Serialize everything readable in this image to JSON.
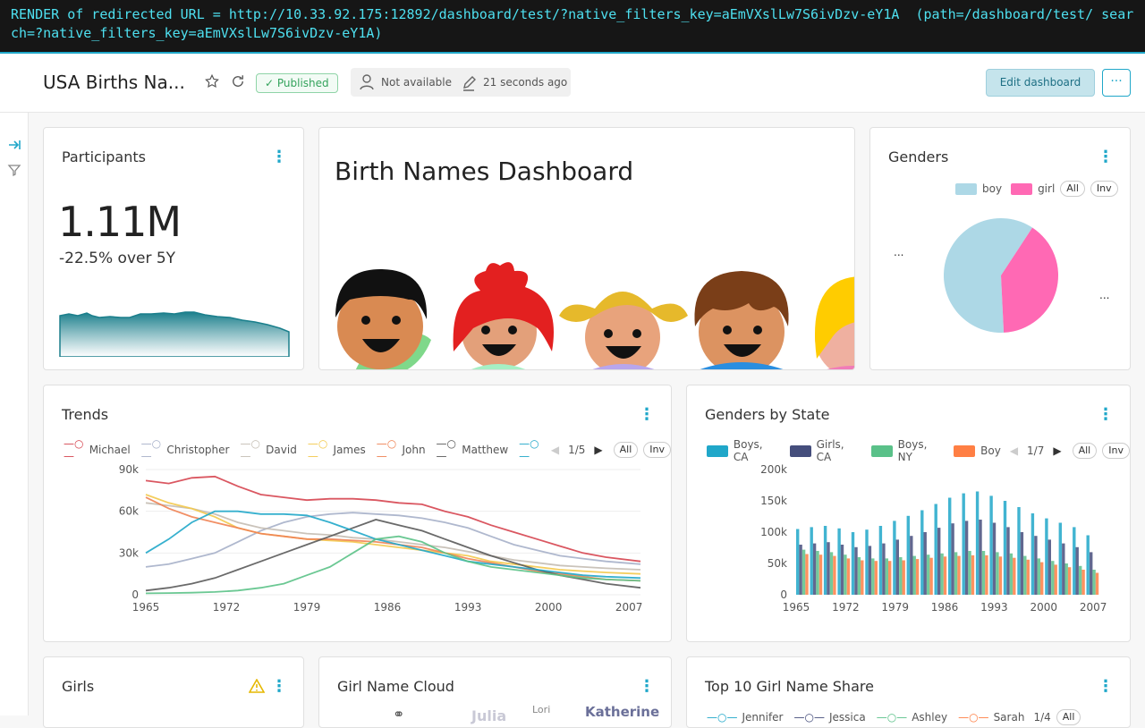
{
  "render_banner": "RENDER of redirected URL = http://10.33.92.175:12892/dashboard/test/?native_filters_key=aEmVXslLw7S6ivDzv-eY1A  (path=/dashboard/test/ search=?native_filters_key=aEmVXslLw7S6ivDzv-eY1A)",
  "header": {
    "title": "USA Births Na...",
    "status": "Published",
    "owner": "Not available",
    "modified": "21 seconds ago",
    "edit_label": "Edit dashboard",
    "more_label": "···"
  },
  "participants": {
    "title": "Participants",
    "big_number": "1.11M",
    "subheader": "-22.5% over 5Y"
  },
  "birthnames": {
    "title": "Birth Names Dashboard"
  },
  "genders": {
    "title": "Genders",
    "legend": [
      "boy",
      "girl"
    ],
    "all_label": "All",
    "inv_label": "Inv",
    "label_left": "...",
    "label_right": "...",
    "chart_data": {
      "type": "pie",
      "categories": [
        "boy",
        "girl"
      ],
      "values": [
        60,
        40
      ],
      "colors": [
        "#add8e6",
        "#ff69b4"
      ]
    }
  },
  "trends": {
    "title": "Trends",
    "legend": [
      "Michael",
      "Christopher",
      "David",
      "James",
      "John",
      "Matthew"
    ],
    "pager": "1/5",
    "all_label": "All",
    "inv_label": "Inv",
    "chart_data": {
      "type": "line",
      "x_ticks": [
        "1965",
        "1972",
        "1979",
        "1986",
        "1993",
        "2000",
        "2007"
      ],
      "y_ticks": [
        "0",
        "30k",
        "60k",
        "90k"
      ],
      "ylim": [
        0,
        90000
      ],
      "xlim": [
        1965,
        2008
      ],
      "x": [
        1965,
        1967,
        1969,
        1971,
        1973,
        1975,
        1977,
        1979,
        1981,
        1983,
        1985,
        1987,
        1989,
        1991,
        1993,
        1995,
        1997,
        1999,
        2001,
        2003,
        2005,
        2008
      ],
      "series": [
        {
          "name": "Michael",
          "color": "#d64550",
          "values": [
            82000,
            80000,
            84000,
            85000,
            78000,
            72000,
            70000,
            68000,
            69000,
            69000,
            68000,
            66000,
            65000,
            60000,
            56000,
            50000,
            45000,
            40000,
            35000,
            30000,
            27000,
            24000
          ]
        },
        {
          "name": "Christopher",
          "color": "#a6b0c9",
          "values": [
            20000,
            22000,
            26000,
            30000,
            38000,
            46000,
            52000,
            56000,
            58000,
            59000,
            58000,
            57000,
            55000,
            52000,
            48000,
            42000,
            36000,
            32000,
            28000,
            26000,
            24000,
            22000
          ]
        },
        {
          "name": "David",
          "color": "#c4bdb3",
          "values": [
            66000,
            64000,
            62000,
            58000,
            52000,
            48000,
            46000,
            44000,
            43000,
            41000,
            40000,
            38000,
            36000,
            34000,
            31000,
            28000,
            25000,
            23000,
            21000,
            20000,
            19000,
            18000
          ]
        },
        {
          "name": "James",
          "color": "#f3c94c",
          "values": [
            72000,
            66000,
            62000,
            56000,
            48000,
            44000,
            42000,
            40000,
            39000,
            38000,
            36000,
            34000,
            32000,
            30000,
            28000,
            24000,
            22000,
            20000,
            18000,
            17000,
            16000,
            15000
          ]
        },
        {
          "name": "John",
          "color": "#ef8354",
          "values": [
            70000,
            62000,
            56000,
            52000,
            48000,
            44000,
            42000,
            40000,
            40000,
            39000,
            38000,
            36000,
            34000,
            30000,
            26000,
            23000,
            20000,
            17000,
            15000,
            13000,
            11000,
            10000
          ]
        },
        {
          "name": "Matthew",
          "color": "#5a5a5a",
          "values": [
            3000,
            5000,
            8000,
            12000,
            18000,
            24000,
            30000,
            36000,
            42000,
            48000,
            54000,
            50000,
            46000,
            40000,
            34000,
            28000,
            23000,
            18000,
            14000,
            11000,
            8000,
            5000
          ]
        },
        {
          "name": "",
          "color": "#20a7c9",
          "values": [
            30000,
            40000,
            52000,
            60000,
            60000,
            58000,
            58000,
            57000,
            52000,
            46000,
            40000,
            36000,
            32000,
            28000,
            24000,
            22000,
            20000,
            18000,
            16000,
            14000,
            13000,
            12000
          ]
        },
        {
          "name": "",
          "color": "#5bc287",
          "values": [
            1000,
            1200,
            1500,
            2000,
            3000,
            5000,
            8000,
            14000,
            20000,
            30000,
            40000,
            42000,
            38000,
            30000,
            24000,
            20000,
            18000,
            16000,
            14000,
            12000,
            11000,
            10000
          ]
        }
      ]
    }
  },
  "gbs": {
    "title": "Genders by State",
    "legend": [
      {
        "label": "Boys, CA",
        "color": "#20a7c9"
      },
      {
        "label": "Girls, CA",
        "color": "#454e7c"
      },
      {
        "label": "Boys, NY",
        "color": "#5ac189"
      },
      {
        "label": "Boy",
        "color": "#ff7f44"
      }
    ],
    "pager": "1/7",
    "all_label": "All",
    "inv_label": "Inv",
    "chart_data": {
      "type": "bar",
      "x_ticks": [
        "1965",
        "1972",
        "1979",
        "1986",
        "1993",
        "2000",
        "2007"
      ],
      "y_ticks": [
        "0",
        "50k",
        "100k",
        "150k",
        "200k"
      ],
      "ylim": [
        0,
        200000
      ],
      "xlim": [
        1965,
        2008
      ],
      "series": [
        {
          "name": "Boys, CA",
          "color": "#20a7c9",
          "values": [
            105000,
            108000,
            110000,
            106000,
            100000,
            104000,
            110000,
            118000,
            126000,
            135000,
            145000,
            155000,
            162000,
            165000,
            158000,
            150000,
            140000,
            130000,
            122000,
            115000,
            108000,
            95000
          ]
        },
        {
          "name": "Girls, CA",
          "color": "#454e7c",
          "values": [
            80000,
            82000,
            84000,
            80000,
            76000,
            78000,
            82000,
            88000,
            94000,
            100000,
            107000,
            114000,
            118000,
            120000,
            115000,
            108000,
            100000,
            94000,
            88000,
            82000,
            76000,
            68000
          ]
        },
        {
          "name": "Boys, NY",
          "color": "#5ac189",
          "values": [
            72000,
            70000,
            68000,
            64000,
            60000,
            58000,
            58000,
            60000,
            62000,
            64000,
            66000,
            68000,
            70000,
            70000,
            68000,
            66000,
            62000,
            58000,
            54000,
            50000,
            46000,
            40000
          ]
        },
        {
          "name": "Boy",
          "color": "#ff7f44",
          "values": [
            65000,
            64000,
            62000,
            58000,
            55000,
            54000,
            54000,
            55000,
            57000,
            59000,
            61000,
            62000,
            63000,
            63000,
            61000,
            59000,
            56000,
            52000,
            48000,
            44000,
            40000,
            35000
          ]
        }
      ]
    }
  },
  "girls": {
    "title": "Girls",
    "warning_icon": "warning-icon"
  },
  "cloud": {
    "title": "Girl Name Cloud",
    "words": [
      "Julia",
      "Lori",
      "Katherine"
    ]
  },
  "top10": {
    "title": "Top 10 Girl Name Share",
    "legend": [
      "Jennifer",
      "Jessica",
      "Ashley",
      "Sarah"
    ],
    "pager": "1/4",
    "all_label": "All"
  }
}
